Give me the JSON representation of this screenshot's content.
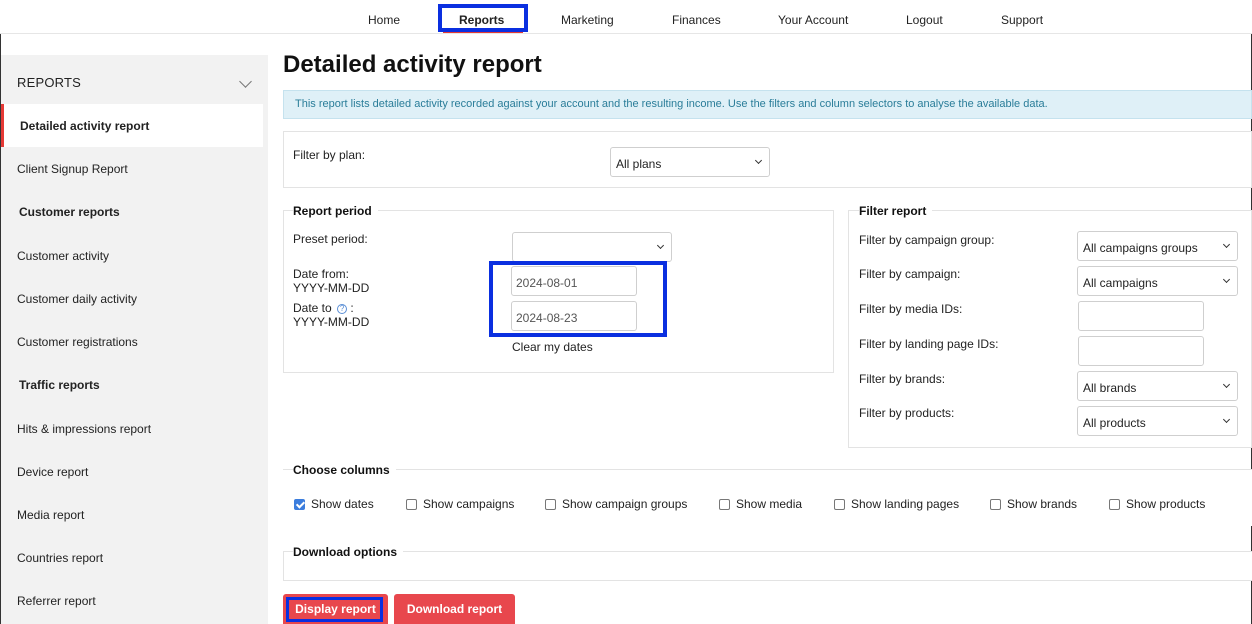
{
  "nav": {
    "items": [
      "Home",
      "Reports",
      "Marketing",
      "Finances",
      "Your Account",
      "Logout",
      "Support"
    ],
    "active": "Reports"
  },
  "sidebar": {
    "section_title": "REPORTS",
    "items": [
      {
        "label": "Detailed activity report",
        "type": "link",
        "active": true
      },
      {
        "label": "Client Signup Report",
        "type": "link"
      },
      {
        "label": "Customer reports",
        "type": "heading"
      },
      {
        "label": "Customer activity",
        "type": "link"
      },
      {
        "label": "Customer daily activity",
        "type": "link"
      },
      {
        "label": "Customer registrations",
        "type": "link"
      },
      {
        "label": "Traffic reports",
        "type": "heading"
      },
      {
        "label": "Hits & impressions report",
        "type": "link"
      },
      {
        "label": "Device report",
        "type": "link"
      },
      {
        "label": "Media report",
        "type": "link"
      },
      {
        "label": "Countries report",
        "type": "link"
      },
      {
        "label": "Referrer report",
        "type": "link"
      }
    ]
  },
  "main": {
    "title": "Detailed activity report",
    "info": "This report lists detailed activity recorded against your account and the resulting income. Use the filters and column selectors to analyse the available data."
  },
  "plan_filter": {
    "label": "Filter by plan:",
    "value": "All plans"
  },
  "report_period": {
    "legend": "Report period",
    "preset_label": "Preset period:",
    "preset_value": "",
    "date_from_label": "Date from:",
    "date_from_format": "YYYY-MM-DD",
    "date_from_value": "2024-08-01",
    "date_to_label": "Date to",
    "date_to_help": "?",
    "date_to_colon": ":",
    "date_to_format": "YYYY-MM-DD",
    "date_to_value": "2024-08-23",
    "clear_label": "Clear my dates"
  },
  "filter_report": {
    "legend": "Filter report",
    "campaign_group_label": "Filter by campaign group:",
    "campaign_group_value": "All campaigns groups",
    "campaign_label": "Filter by campaign:",
    "campaign_value": "All campaigns",
    "media_label": "Filter by media IDs:",
    "media_value": "",
    "landing_label": "Filter by landing page IDs:",
    "landing_value": "",
    "brands_label": "Filter by brands:",
    "brands_value": "All brands",
    "products_label": "Filter by products:",
    "products_value": "All products"
  },
  "columns": {
    "legend": "Choose columns",
    "options": [
      {
        "label": "Show dates",
        "checked": true
      },
      {
        "label": "Show campaigns",
        "checked": false
      },
      {
        "label": "Show campaign groups",
        "checked": false
      },
      {
        "label": "Show media",
        "checked": false
      },
      {
        "label": "Show landing pages",
        "checked": false
      },
      {
        "label": "Show brands",
        "checked": false
      },
      {
        "label": "Show products",
        "checked": false
      }
    ]
  },
  "download": {
    "legend": "Download options"
  },
  "actions": {
    "display_label": "Display report",
    "download_label": "Download report"
  },
  "colors": {
    "accent_red": "#e8474d",
    "highlight_blue": "#0a2fe0",
    "info_bg": "#dff0f7",
    "info_text": "#2a7d99",
    "checkbox_blue": "#3b7ddd"
  }
}
